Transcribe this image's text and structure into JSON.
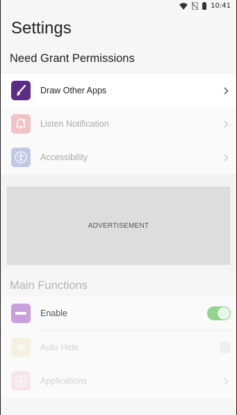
{
  "status_bar": {
    "time": "10:41"
  },
  "page_title": "Settings",
  "permissions": {
    "header": "Need Grant Permissions",
    "items": [
      {
        "label": "Draw Other Apps",
        "icon": "paintbrush-icon",
        "color": "#5b2b86"
      },
      {
        "label": "Listen Notification",
        "icon": "bell-icon",
        "color": "#e9787f"
      },
      {
        "label": "Accessibility",
        "icon": "accessibility-icon",
        "color": "#6c86c8"
      }
    ]
  },
  "advertisement": {
    "label": "ADVERTISEMENT"
  },
  "main_functions": {
    "header": "Main Functions",
    "items": [
      {
        "label": "Enable",
        "icon": "enable-icon",
        "color": "#b57acb",
        "toggle": "on"
      },
      {
        "label": "Auto Hide",
        "icon": "auto-hide-icon",
        "color": "#e8c56a",
        "toggle": "off"
      },
      {
        "label": "Applications",
        "icon": "applications-icon",
        "color": "#e58fa8"
      }
    ]
  },
  "colors": {
    "accent_toggle": "#8fd48f",
    "background": "#f6f6f6"
  }
}
